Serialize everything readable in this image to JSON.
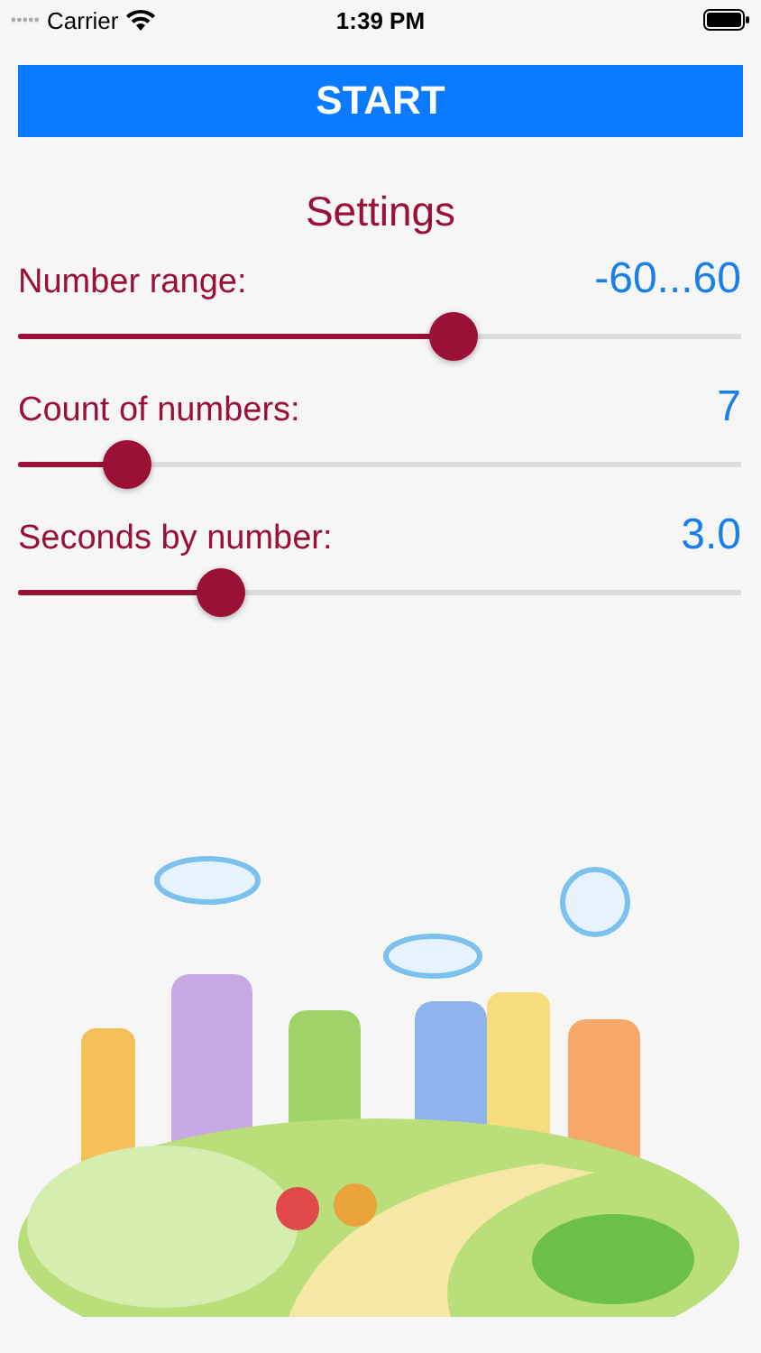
{
  "status_bar": {
    "carrier": "Carrier",
    "time": "1:39 PM"
  },
  "start_button": {
    "label": "START"
  },
  "settings": {
    "title": "Settings",
    "rows": [
      {
        "label": "Number range:",
        "value": "-60...60",
        "level": 0.6
      },
      {
        "label": "Count of numbers:",
        "value": "7",
        "level": 0.15
      },
      {
        "label": "Seconds by number:",
        "value": "3.0",
        "level": 0.28
      }
    ]
  }
}
